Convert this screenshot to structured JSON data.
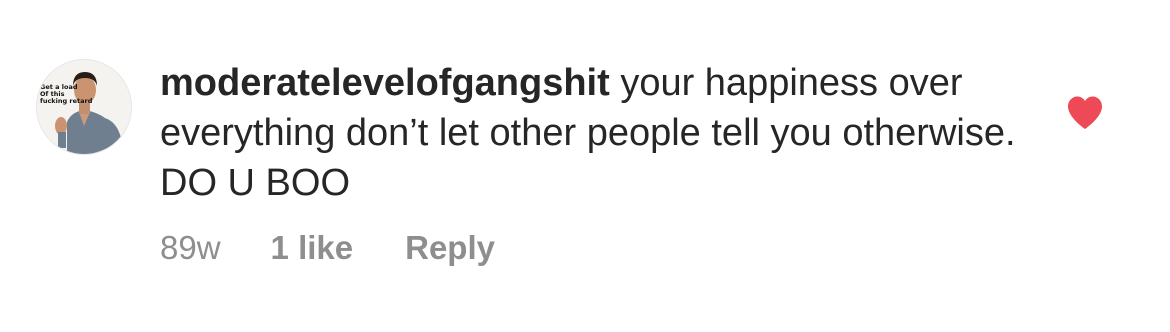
{
  "comment": {
    "avatar": {
      "caption_lines": "Get a load\nOf this\nfucking retard"
    },
    "username": "moderatelevelofgangshit",
    "text": " your happiness over everything don’t let other people tell you otherwise. DO U BOO",
    "timestamp": "89w",
    "likes_label": "1 like",
    "reply_label": "Reply",
    "liked": true,
    "heart_icon": "heart-filled-icon",
    "colors": {
      "heart": "#ed4956",
      "text": "#262626",
      "meta": "#8e8e8e"
    }
  }
}
